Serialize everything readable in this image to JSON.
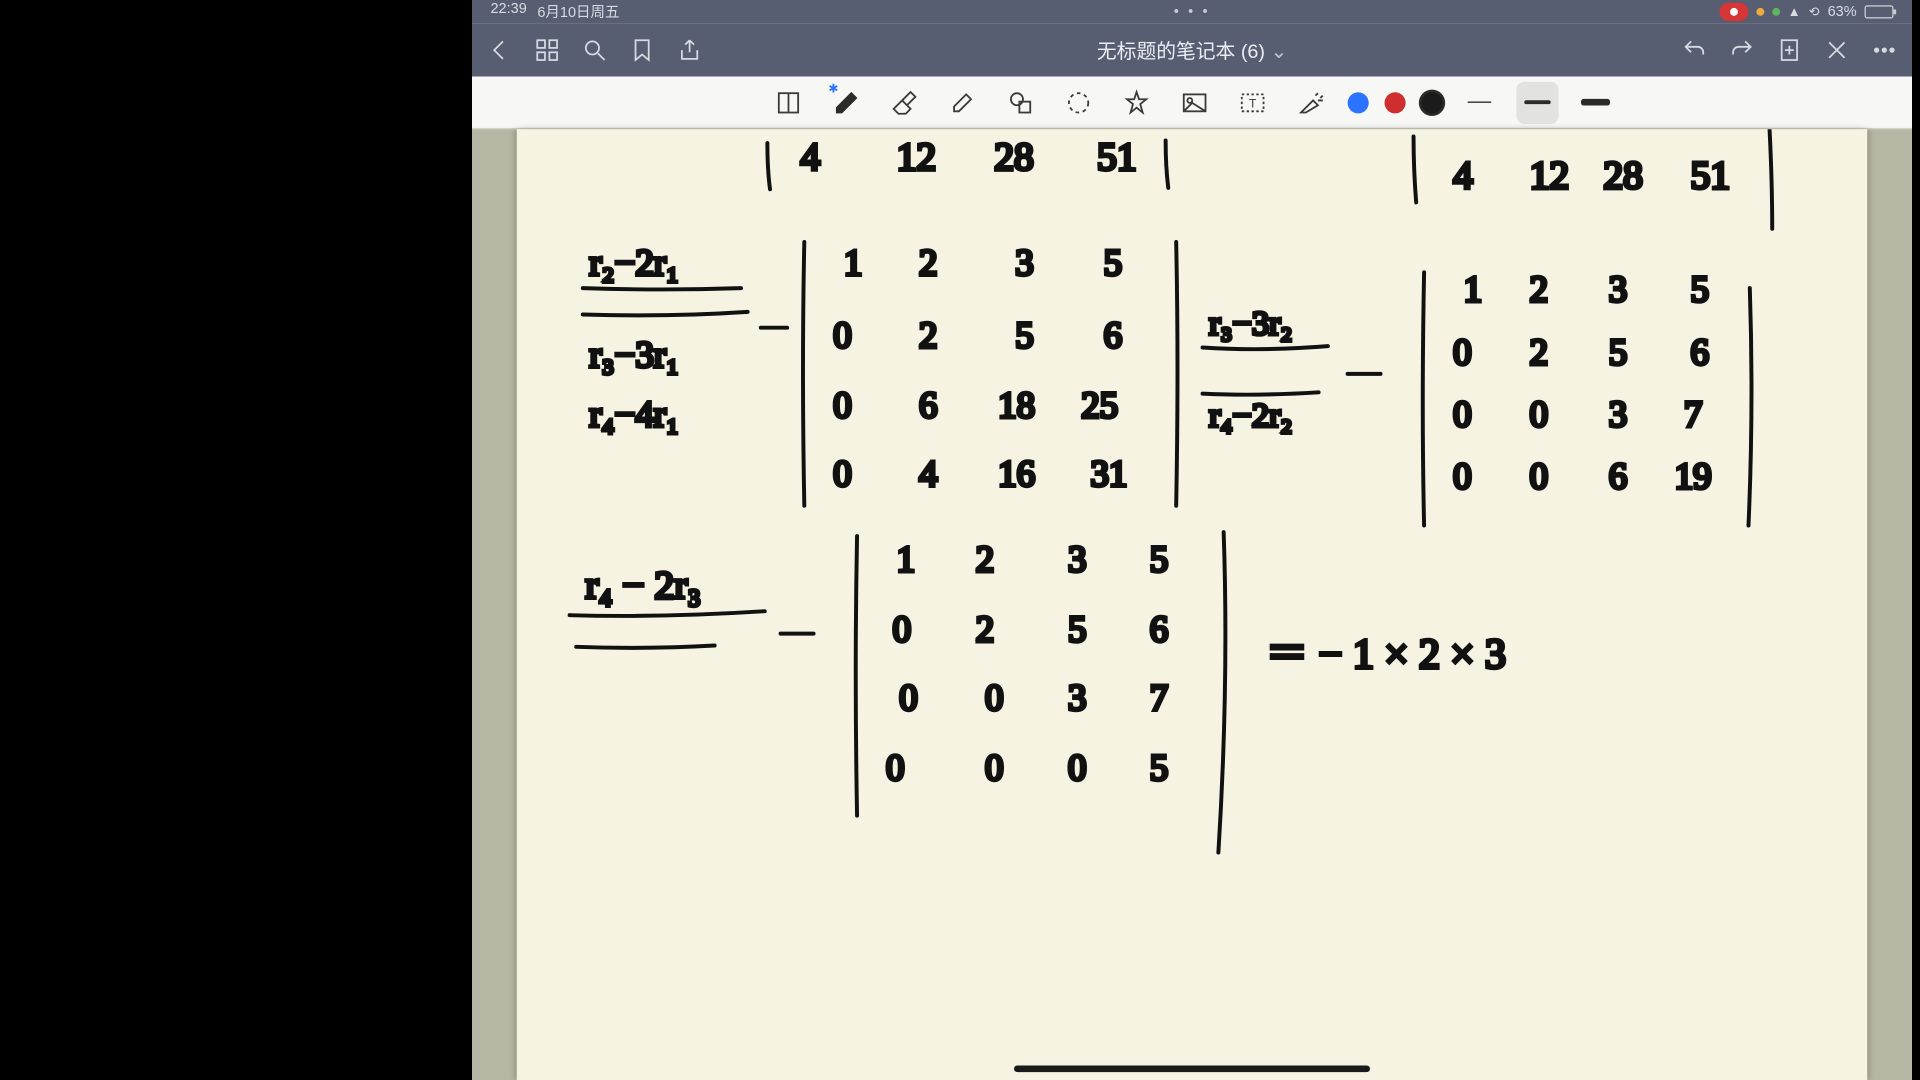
{
  "status": {
    "time": "22:39",
    "date": "6月10日周五",
    "ellipsis": "• • •",
    "battery_pct": "63%",
    "battery_fill": 63,
    "wifi_glyph": "⟟",
    "orientation_glyph": "⟳"
  },
  "nav": {
    "doc_title": "无标题的笔记本 (6)",
    "dropdown_glyph": "⌄"
  },
  "toolbar": {
    "colors": {
      "blue": "#2c73ff",
      "red": "#cf2e2e",
      "black": "#1b1b1b"
    }
  },
  "notes": {
    "top_row_left": [
      "4",
      "12",
      "28",
      "51"
    ],
    "top_row_right": [
      "4",
      "12",
      "28",
      "51"
    ],
    "step1_labels": [
      "r₂−2r₁",
      "r₃−3r₁",
      "r₄−4r₁"
    ],
    "step1_matrix": [
      [
        "1",
        "2",
        "3",
        "5"
      ],
      [
        "0",
        "2",
        "5",
        "6"
      ],
      [
        "0",
        "6",
        "18",
        "25"
      ],
      [
        "0",
        "4",
        "16",
        "31"
      ]
    ],
    "step2_labels": [
      "r₃−3r₂",
      "r₄−2r₂"
    ],
    "step2_matrix": [
      [
        "1",
        "2",
        "3",
        "5"
      ],
      [
        "0",
        "2",
        "5",
        "6"
      ],
      [
        "0",
        "0",
        "3",
        "7"
      ],
      [
        "0",
        "0",
        "6",
        "19"
      ]
    ],
    "step3_label": "r₄ − 2r₃",
    "step3_matrix": [
      [
        "1",
        "2",
        "3",
        "5"
      ],
      [
        "0",
        "2",
        "5",
        "6"
      ],
      [
        "0",
        "0",
        "3",
        "7"
      ],
      [
        "0",
        "0",
        "0",
        "5"
      ]
    ],
    "result_expr": "＝  −  1 × 2 × 3"
  }
}
